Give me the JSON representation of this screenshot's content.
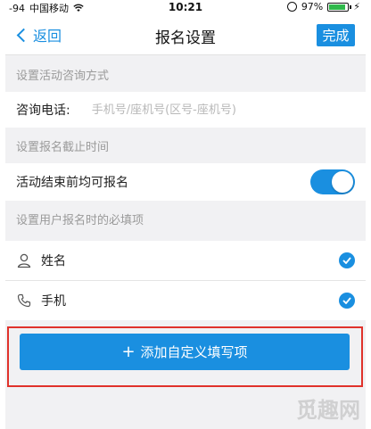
{
  "status_bar": {
    "signal": "-94",
    "carrier": "中国移动",
    "time": "10:21",
    "battery": "97%"
  },
  "nav": {
    "back_label": "返回",
    "title": "报名设置",
    "done_label": "完成"
  },
  "sections": {
    "consult_header": "设置活动咨询方式",
    "phone_label": "咨询电话:",
    "phone_placeholder": "手机号/座机号(区号-座机号)",
    "phone_value": "",
    "deadline_header": "设置报名截止时间",
    "deadline_label": "活动结束前均可报名",
    "deadline_toggle_on": true,
    "required_header": "设置用户报名时的必填项"
  },
  "required_fields": [
    {
      "label": "姓名",
      "icon": "person-icon",
      "checked": true
    },
    {
      "label": "手机",
      "icon": "phone-icon",
      "checked": true
    }
  ],
  "add_button": {
    "label": "添加自定义填写项"
  },
  "watermark": "觅趣网",
  "colors": {
    "accent": "#1a8fe0",
    "highlight": "#e0322b",
    "background": "#f1f1f3"
  }
}
